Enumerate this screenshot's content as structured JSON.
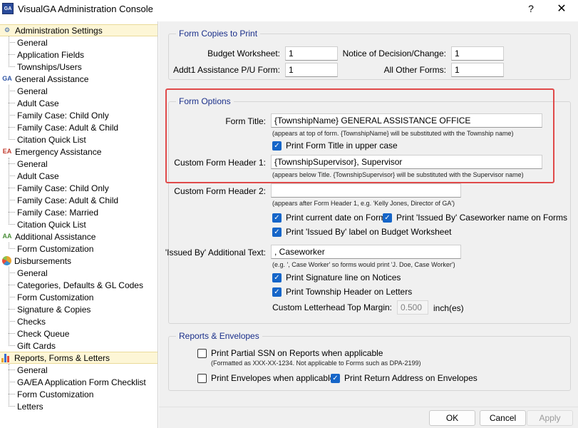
{
  "window": {
    "title": "VisualGA Administration Console",
    "app_icon_text": "GA",
    "help_button": "?",
    "close_button": "✕"
  },
  "sidebar": {
    "sections": [
      {
        "label": "Administration Settings",
        "icon": "admin-settings-icon",
        "selected": true,
        "children": [
          "General",
          "Application Fields",
          "Townships/Users"
        ]
      },
      {
        "label": "General Assistance",
        "icon": "ga-icon",
        "selected": false,
        "children": [
          "General",
          "Adult Case",
          "Family Case: Child Only",
          "Family Case: Adult & Child",
          "Citation Quick List"
        ]
      },
      {
        "label": "Emergency Assistance",
        "icon": "ea-icon",
        "selected": false,
        "children": [
          "General",
          "Adult Case",
          "Family Case: Child Only",
          "Family Case: Adult & Child",
          "Family Case: Married",
          "Citation Quick List"
        ]
      },
      {
        "label": "Additional Assistance",
        "icon": "aa-icon",
        "selected": false,
        "children": [
          "Form Customization"
        ]
      },
      {
        "label": "Disbursements",
        "icon": "pie-chart-icon",
        "selected": false,
        "children": [
          "General",
          "Categories, Defaults & GL Codes",
          "Form Customization",
          "Signature & Copies",
          "Checks",
          "Check Queue",
          "Gift Cards"
        ]
      },
      {
        "label": "Reports, Forms & Letters",
        "icon": "bar-chart-icon",
        "selected": true,
        "children": [
          "General",
          "GA/EA Application Form Checklist",
          "Form Customization",
          "Letters"
        ]
      }
    ]
  },
  "form_copies": {
    "title": "Form Copies to Print",
    "budget_worksheet_label": "Budget Worksheet:",
    "budget_worksheet_value": "1",
    "notice_label": "Notice of Decision/Change:",
    "notice_value": "1",
    "addtl_label": "Addt1 Assistance P/U Form:",
    "addtl_value": "1",
    "other_label": "All Other Forms:",
    "other_value": "1"
  },
  "form_options": {
    "title": "Form Options",
    "form_title_label": "Form Title:",
    "form_title_value": "{TownshipName} GENERAL ASSISTANCE OFFICE",
    "form_title_hint": "(appears at top of form. {TownshipName} will be substituted with the Township name)",
    "print_upper_label": "Print Form Title in upper case",
    "print_upper_checked": true,
    "header1_label": "Custom Form Header 1:",
    "header1_value": "{TownshipSupervisor}, Supervisor",
    "header1_hint": "(appears below Title. {TownshipSupervisor} will be substituted with the Supervisor name)",
    "header2_label": "Custom Form Header 2:",
    "header2_value": "",
    "header2_hint": "(appears after Form Header 1, e.g. 'Kelly Jones, Director of GA')",
    "print_date_label": "Print current date on Forms",
    "print_date_checked": true,
    "print_issued_name_label": "Print 'Issued By' Caseworker name on Forms",
    "print_issued_name_checked": true,
    "print_issued_label_label": "Print 'Issued By' label on Budget Worksheet",
    "print_issued_label_checked": true,
    "issued_text_label": "'Issued By' Additional Text:",
    "issued_text_value": ", Caseworker",
    "issued_text_hint": "(e.g. ', Case Worker' so forms would print 'J. Doe, Case Worker')",
    "print_signature_label": "Print Signature line on Notices",
    "print_signature_checked": true,
    "print_township_header_label": "Print Township Header on Letters",
    "print_township_header_checked": true,
    "margin_label": "Custom Letterhead Top Margin:",
    "margin_value": "0.500",
    "margin_unit": "inch(es)"
  },
  "reports_envelopes": {
    "title": "Reports & Envelopes",
    "partial_ssn_label": "Print Partial SSN on Reports when applicable",
    "partial_ssn_checked": false,
    "partial_ssn_hint": "(Formatted as XXX-XX-1234. Not applicable to Forms such as DPA-2199)",
    "envelopes_label": "Print Envelopes when applicable",
    "envelopes_checked": false,
    "return_address_label": "Print Return Address on Envelopes",
    "return_address_checked": true
  },
  "buttons": {
    "ok": "OK",
    "cancel": "Cancel",
    "apply": "Apply"
  },
  "check_glyph": "✓"
}
